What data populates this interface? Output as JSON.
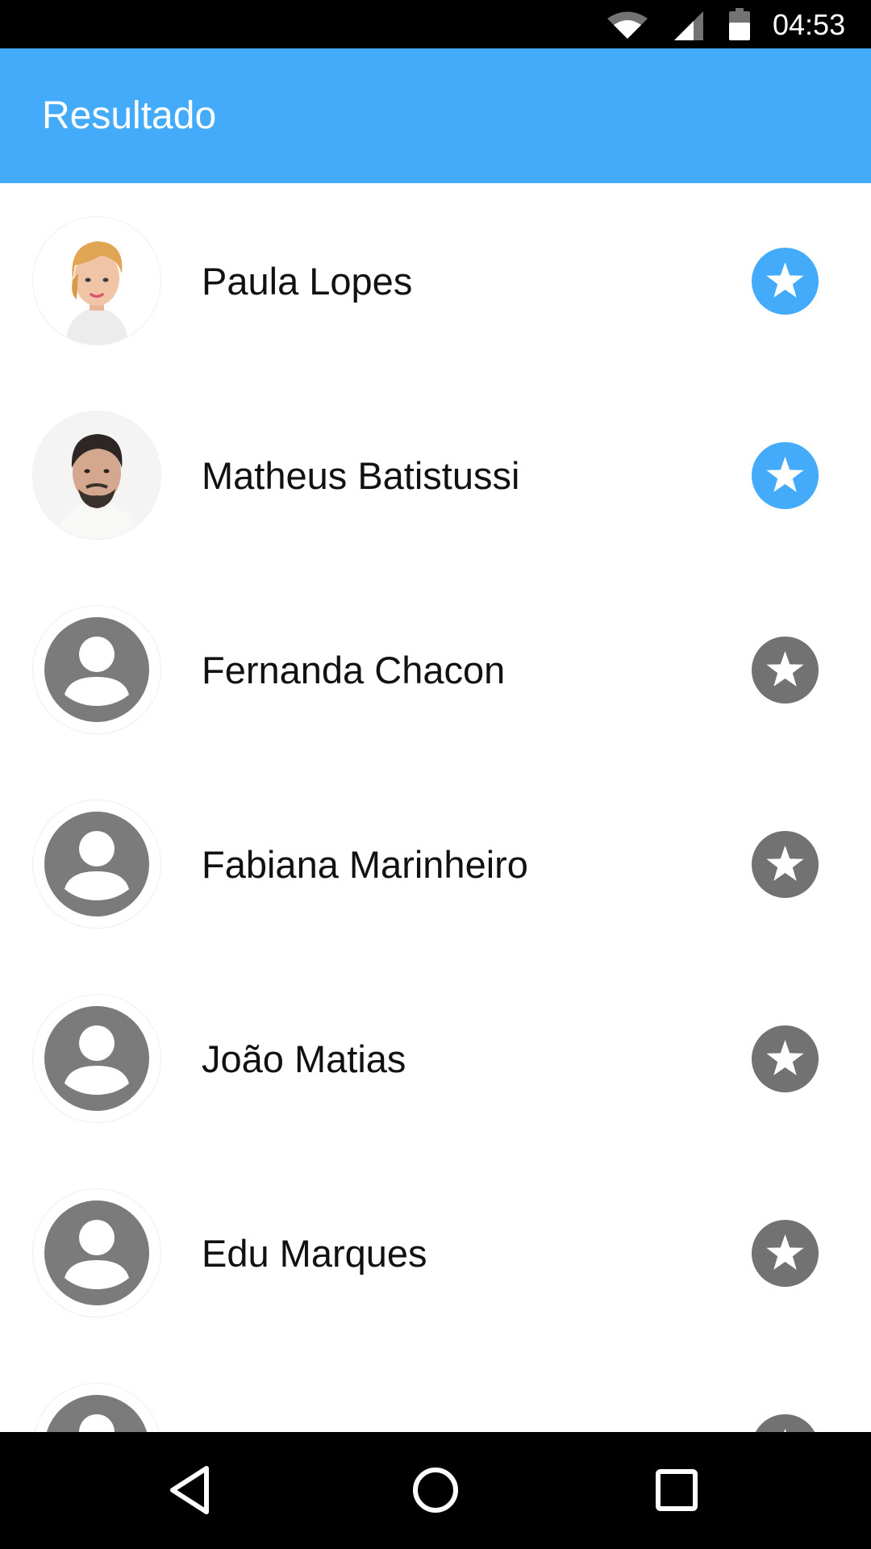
{
  "status_bar": {
    "time": "04:53",
    "icons": [
      "wifi-icon",
      "cell-signal-icon",
      "battery-icon"
    ]
  },
  "app_bar": {
    "title": "Resultado"
  },
  "contacts": [
    {
      "name": "Paula Lopes",
      "avatar": "photo-woman-avatar",
      "favorite": true
    },
    {
      "name": "Matheus Batistussi",
      "avatar": "photo-man-avatar",
      "favorite": true
    },
    {
      "name": "Fernanda Chacon",
      "avatar": "default-person-icon",
      "favorite": false
    },
    {
      "name": "Fabiana Marinheiro",
      "avatar": "default-person-icon",
      "favorite": false
    },
    {
      "name": "João Matias",
      "avatar": "default-person-icon",
      "favorite": false
    },
    {
      "name": "Edu Marques",
      "avatar": "default-person-icon",
      "favorite": false
    },
    {
      "name": "",
      "avatar": "default-person-icon",
      "favorite": false
    }
  ],
  "nav_bar": {
    "buttons": [
      "back-icon",
      "home-icon",
      "recents-icon"
    ]
  },
  "colors": {
    "app_bar": "#44aafa",
    "favorite_active": "#44aafa",
    "favorite_inactive": "#727272",
    "placeholder_avatar": "#7b7b7b",
    "status_bar": "#000000",
    "nav_bar": "#000000"
  }
}
